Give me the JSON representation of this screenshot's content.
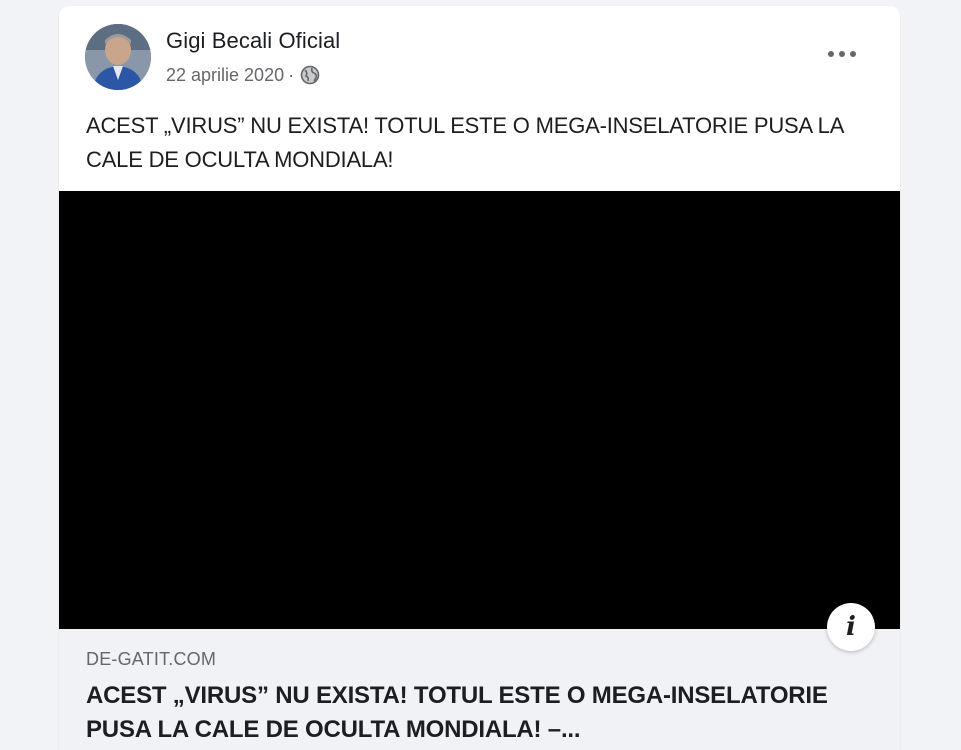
{
  "post": {
    "author": "Gigi Becali Oficial",
    "date": "22 aprilie 2020",
    "separator": "·",
    "privacy_icon": "globe-icon",
    "more_icon": "more-options-icon",
    "text": "ACEST „VIRUS” NU EXISTA! TOTUL ESTE O MEGA-INSELATORIE PUSA LA CALE DE OCULTA MONDIALA!"
  },
  "video": {
    "background": "#000000"
  },
  "link_preview": {
    "domain": "DE-GATIT.COM",
    "title": "ACEST „VIRUS” NU EXISTA! TOTUL ESTE O MEGA-INSELATORIE PUSA LA CALE DE OCULTA MONDIALA! –...",
    "info_icon": "info-icon",
    "info_glyph": "i"
  },
  "colors": {
    "card_bg": "#ffffff",
    "page_bg": "#f2f3f7",
    "preview_bg": "#f0f2f5",
    "primary_text": "#1c1e21",
    "secondary_text": "#65676b"
  }
}
